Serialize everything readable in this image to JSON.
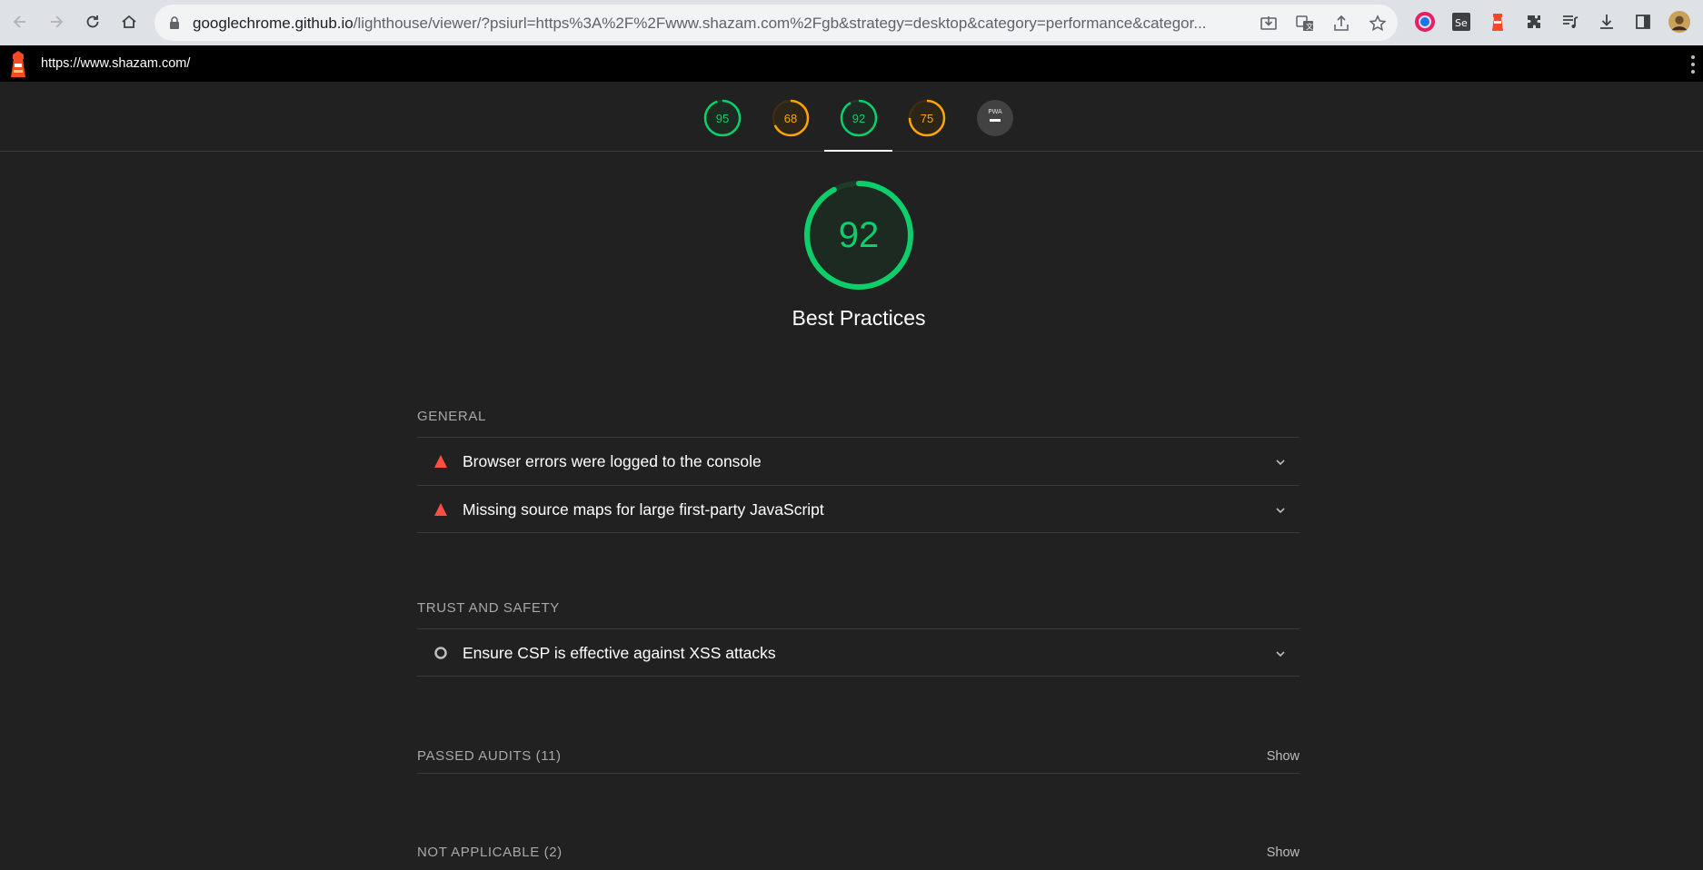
{
  "browser": {
    "url_host": "googlechrome.github.io",
    "url_path": "/lighthouse/viewer/?psiurl=https%3A%2F%2Fwww.shazam.com%2Fgb&strategy=desktop&category=performance&categor..."
  },
  "lighthouse": {
    "page_url": "https://www.shazam.com/",
    "gauges": [
      {
        "score": "95",
        "color": "#0cce6b",
        "fraction": 0.95
      },
      {
        "score": "68",
        "color": "#ffa400",
        "fraction": 0.68
      },
      {
        "score": "92",
        "color": "#0cce6b",
        "fraction": 0.92
      },
      {
        "score": "75",
        "color": "#ffa400",
        "fraction": 0.75
      },
      {
        "score": "PWA",
        "color": "#9e9e9e"
      }
    ],
    "category": {
      "score": "92",
      "fraction": 0.92,
      "title": "Best Practices"
    },
    "groups": {
      "general": {
        "title": "GENERAL",
        "audits": [
          {
            "label": "Browser errors were logged to the console",
            "status": "fail"
          },
          {
            "label": "Missing source maps for large first-party JavaScript",
            "status": "fail"
          }
        ]
      },
      "trust": {
        "title": "TRUST AND SAFETY",
        "audits": [
          {
            "label": "Ensure CSP is effective against XSS attacks",
            "status": "informative"
          }
        ]
      }
    },
    "passed": {
      "title": "PASSED AUDITS (11)",
      "show": "Show"
    },
    "not_applicable": {
      "title": "NOT APPLICABLE (2)",
      "show": "Show"
    }
  },
  "colors": {
    "pass": "#0cce6b",
    "average": "#ffa400",
    "fail": "#ff4e42"
  }
}
